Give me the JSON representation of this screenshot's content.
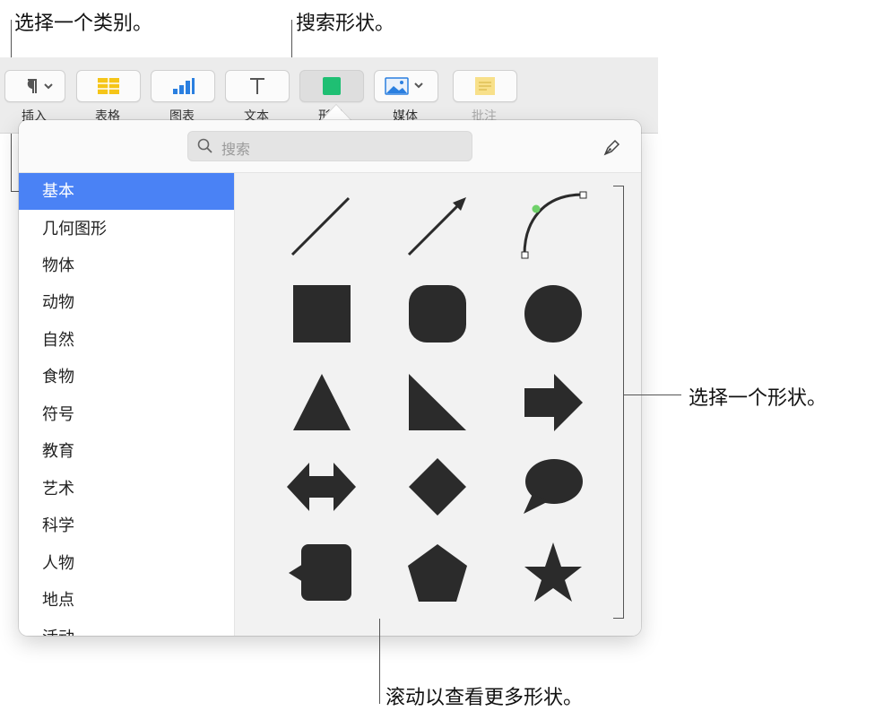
{
  "annotations": {
    "choose_category": "选择一个类别。",
    "search_shapes": "搜索形状。",
    "choose_shape": "选择一个形状。",
    "scroll_more": "滚动以查看更多形状。"
  },
  "toolbar": {
    "items": [
      {
        "label": "插入",
        "icon": "paragraph-icon"
      },
      {
        "label": "表格",
        "icon": "table-icon"
      },
      {
        "label": "图表",
        "icon": "chart-icon"
      },
      {
        "label": "文本",
        "icon": "text-icon"
      },
      {
        "label": "形状",
        "icon": "shape-icon"
      },
      {
        "label": "媒体",
        "icon": "media-icon"
      },
      {
        "label": "批注",
        "icon": "comment-icon"
      }
    ],
    "colors": {
      "table": "#f5c518",
      "chart": "#2a7fe0",
      "shape": "#1fbf73",
      "comment": "#f8e08a"
    }
  },
  "popover": {
    "search_placeholder": "搜索",
    "categories": [
      "基本",
      "几何图形",
      "物体",
      "动物",
      "自然",
      "食物",
      "符号",
      "教育",
      "艺术",
      "科学",
      "人物",
      "地点",
      "活动"
    ],
    "selected_category": "基本",
    "shapes": [
      "line-shape",
      "arrow-line-shape",
      "curve-shape",
      "square-shape",
      "rounded-square-shape",
      "circle-shape",
      "triangle-shape",
      "right-triangle-shape",
      "arrow-shape",
      "double-arrow-shape",
      "diamond-shape",
      "speech-bubble-shape",
      "callout-square-shape",
      "pentagon-shape",
      "star-shape"
    ],
    "shape_color": "#2b2b2b",
    "accent": "#4a82f5"
  }
}
